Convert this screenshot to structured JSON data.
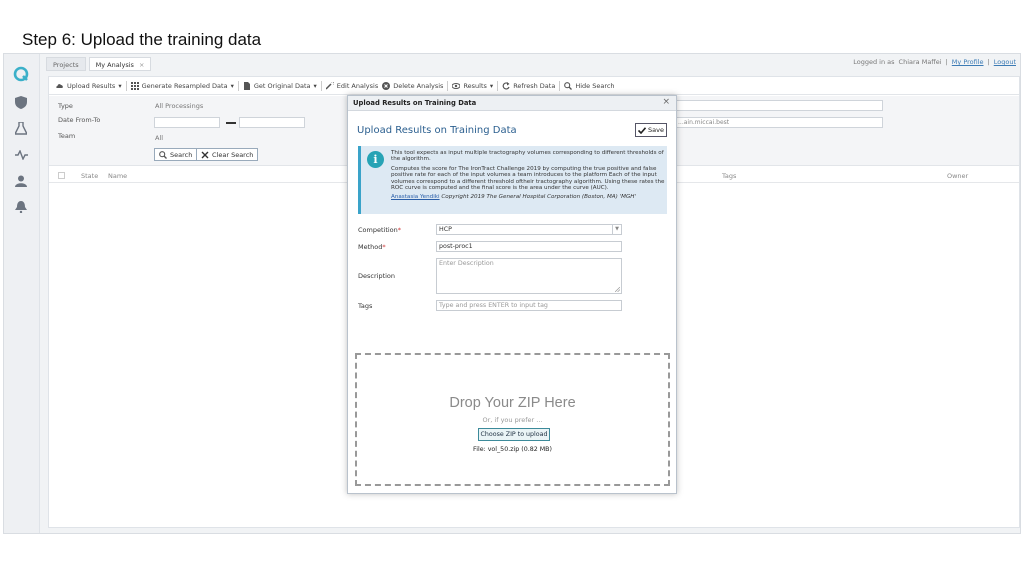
{
  "slide": {
    "title": "Step 6: Upload the training data"
  },
  "tabs": [
    {
      "label": "Projects"
    },
    {
      "label": "My Analysis"
    }
  ],
  "user": {
    "logged_in": "Logged in as",
    "name": "Chiara Maffei",
    "profile": "My Profile",
    "logout": "Logout"
  },
  "toolbar": {
    "upload": "Upload Results",
    "generate": "Generate Resampled Data",
    "get_original": "Get Original Data",
    "edit": "Edit Analysis",
    "delete": "Delete Analysis",
    "results": "Results",
    "refresh": "Refresh Data",
    "hide_search": "Hide Search"
  },
  "filters": {
    "type_label": "Type",
    "type_value": "All Processings",
    "date_label": "Date From-To",
    "team_label": "Team",
    "team_value": "All",
    "search": "Search",
    "clear": "Clear Search",
    "hidden_value": "...ain.miccai.best"
  },
  "table": {
    "columns": [
      "State",
      "Name",
      "Tags",
      "Owner"
    ]
  },
  "dialog": {
    "header": "Upload Results on Training Data",
    "title": "Upload Results on Training Data",
    "save": "Save",
    "info_line1": "This tool expects as input multiple tractography volumes corresponding to different thresholds of the algorithm.",
    "info_line2": "Computes the score for The IronTract Challenge 2019 by computing the true positive and false positive rate for each of the input volumes a team introduces to the platform Each of the input volumes correspond to a different threshold oftheir tractography algorithm. Using these rates the ROC curve is computed and the final score is the area under the curve (AUC).",
    "info_author": "Anastasia Yendiki",
    "info_copyright": "Copyright 2019 The General Hospital Corporation (Boston, MA) 'MGH'",
    "competition_label": "Competition",
    "competition_value": "HCP",
    "method_label": "Method",
    "method_value": "post-proc1",
    "description_label": "Description",
    "description_placeholder": "Enter Description",
    "tags_label": "Tags",
    "tags_placeholder": "Type and press ENTER to input tag",
    "drop_title": "Drop Your ZIP Here",
    "drop_sub": "Or, if you prefer ...",
    "choose": "Choose ZIP to upload",
    "file": "File: vol_50.zip (0.82 MB)"
  },
  "colors": {
    "accent": "#2b5f8f",
    "info_bg": "#dde9f3",
    "info_icon": "#27a3b5"
  }
}
